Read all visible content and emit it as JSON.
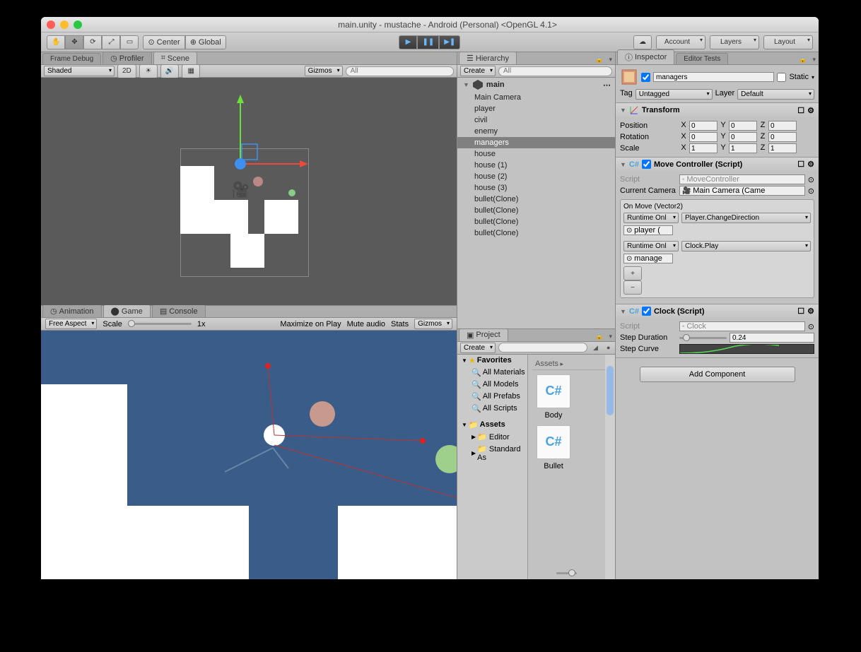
{
  "window": {
    "title": "main.unity - mustache - Android (Personal) <OpenGL 4.1>"
  },
  "toolbar": {
    "center": "Center",
    "global": "Global",
    "account": "Account",
    "layers": "Layers",
    "layout": "Layout"
  },
  "tabs": {
    "frame_debug": "Frame Debug",
    "profiler": "Profiler",
    "scene": "Scene",
    "animation": "Animation",
    "game": "Game",
    "console": "Console",
    "hierarchy": "Hierarchy",
    "project": "Project",
    "inspector": "Inspector",
    "editor_tests": "Editor Tests"
  },
  "scene_bar": {
    "shaded": "Shaded",
    "twod": "2D",
    "gizmos": "Gizmos",
    "qall_placeholder": "All"
  },
  "game_bar": {
    "free_aspect": "Free Aspect",
    "scale": "Scale",
    "scale_val": "1x",
    "maximize": "Maximize on Play",
    "mute": "Mute audio",
    "stats": "Stats",
    "gizmos": "Gizmos"
  },
  "hierarchy": {
    "create": "Create",
    "search_placeholder": "All",
    "root": "main",
    "items": [
      "Main Camera",
      "player",
      "civil",
      "enemy",
      "managers",
      "house",
      "house (1)",
      "house (2)",
      "house (3)",
      "bullet(Clone)",
      "bullet(Clone)",
      "bullet(Clone)",
      "bullet(Clone)"
    ],
    "selected_index": 4
  },
  "project": {
    "create": "Create",
    "favorites": "Favorites",
    "fav_items": [
      "All Materials",
      "All Models",
      "All Prefabs",
      "All Scripts"
    ],
    "assets": "Assets",
    "asset_folders": [
      "Editor",
      "Standard As"
    ],
    "breadcrumb": "Assets",
    "grid_items": [
      "Body",
      "Bullet"
    ]
  },
  "inspector": {
    "name": "managers",
    "static": "Static",
    "tag_label": "Tag",
    "tag_value": "Untagged",
    "layer_label": "Layer",
    "layer_value": "Default",
    "transform": {
      "title": "Transform",
      "position": "Position",
      "rotation": "Rotation",
      "scale": "Scale",
      "px": "0",
      "py": "0",
      "pz": "0",
      "rx": "0",
      "ry": "0",
      "rz": "0",
      "sx": "1",
      "sy": "1",
      "sz": "1"
    },
    "movectrl": {
      "title": "Move Controller (Script)",
      "script_label": "Script",
      "script_value": "MoveController",
      "camera_label": "Current Camera",
      "camera_value": "Main Camera (Came",
      "onmove": "On Move (Vector2)",
      "ev1_mode": "Runtime Onl",
      "ev1_method": "Player.ChangeDirection",
      "ev1_target": "player (",
      "ev2_mode": "Runtime Onl",
      "ev2_method": "Clock.Play",
      "ev2_target": "manage"
    },
    "clock": {
      "title": "Clock (Script)",
      "script_label": "Script",
      "script_value": "Clock",
      "step_duration": "Step Duration",
      "step_duration_val": "0.24",
      "step_curve": "Step Curve"
    },
    "add_component": "Add Component"
  }
}
